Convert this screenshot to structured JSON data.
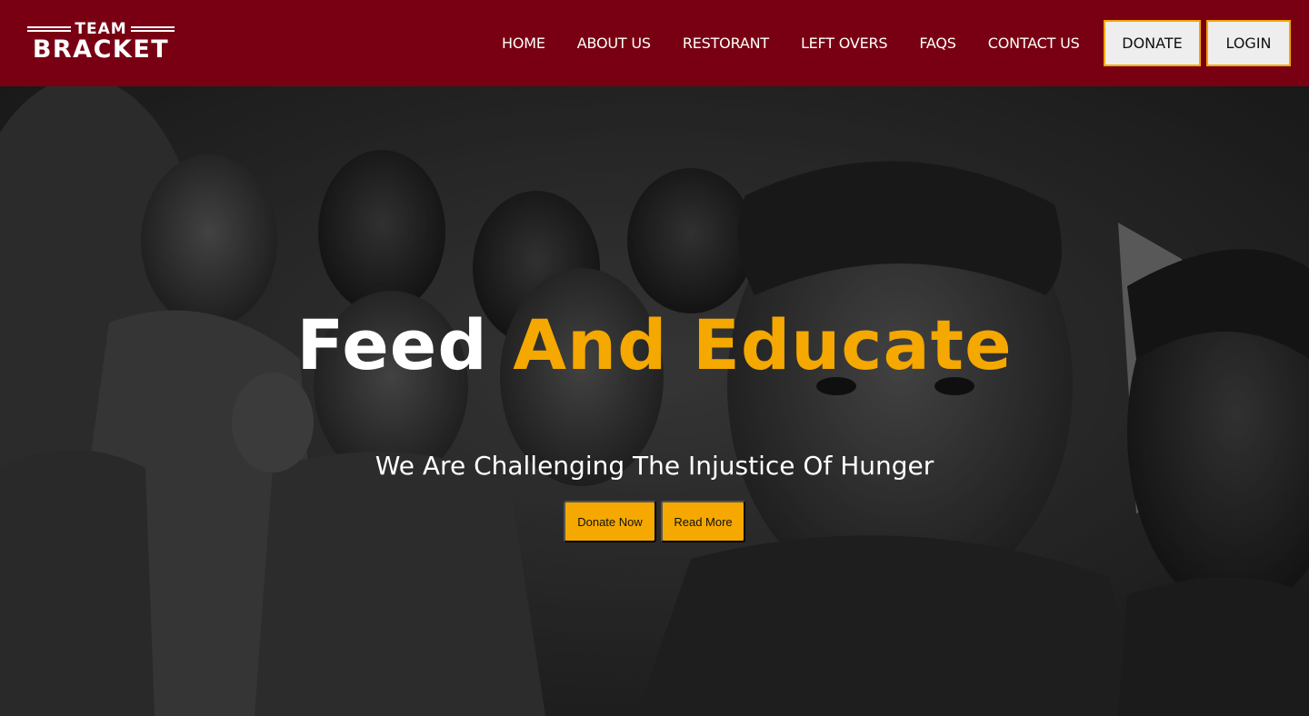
{
  "brand": {
    "logo_top": "TEAM",
    "logo_main": "BRACKET"
  },
  "nav": {
    "links": [
      "HOME",
      "ABOUT US",
      "RESTORANT",
      "LEFT OVERS",
      "FAQS",
      "CONTACT US"
    ],
    "donate_label": "DONATE",
    "login_label": "LOGIN"
  },
  "hero": {
    "title_plain": "Feed",
    "title_accent": "And Educate",
    "subtitle": "We Are Challenging The Injustice Of Hunger",
    "primary_button": "Donate Now",
    "secondary_button": "Read More"
  },
  "colors": {
    "navbar_bg": "#780012",
    "accent": "#f5a800",
    "nav_button_bg": "#eeeeee"
  }
}
